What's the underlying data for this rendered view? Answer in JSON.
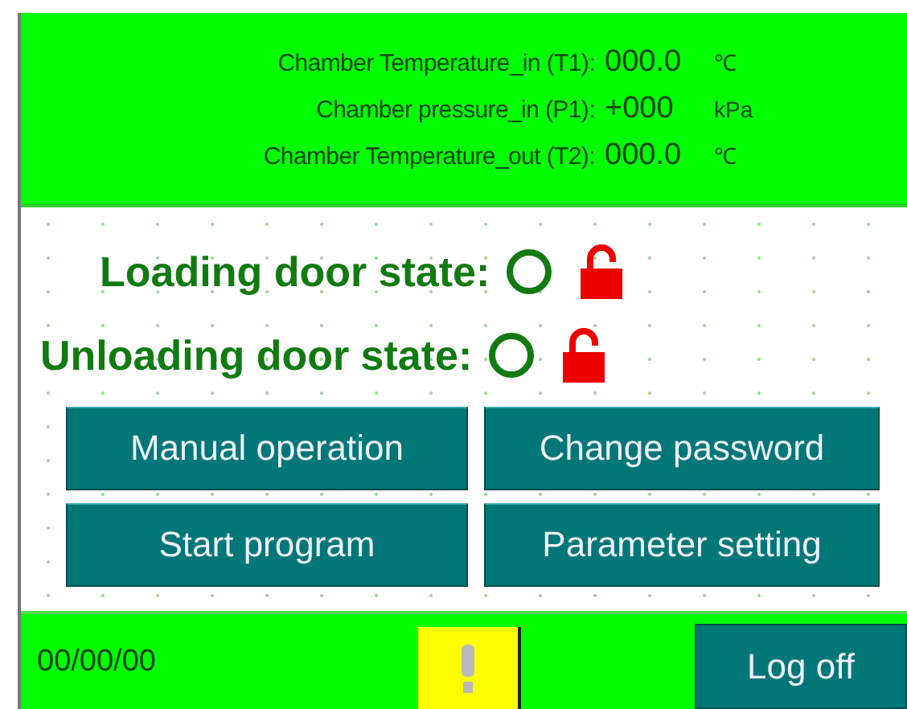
{
  "readings": [
    {
      "label": "Chamber Temperature_in (T1):",
      "value": "000.0",
      "unit": "℃"
    },
    {
      "label": "Chamber pressure_in (P1):",
      "value": "+000",
      "unit": "kPa"
    },
    {
      "label": "Chamber Temperature_out (T2):",
      "value": "000.0",
      "unit": "℃"
    }
  ],
  "doors": [
    {
      "label": "Loading door state:",
      "locked": false
    },
    {
      "label": "Unloading door state:",
      "locked": false
    }
  ],
  "buttons": [
    "Manual operation",
    "Change password",
    "Start program",
    "Parameter setting"
  ],
  "status_bar": {
    "date": "00/00/00",
    "alarm": true,
    "logoff": "Log off"
  }
}
